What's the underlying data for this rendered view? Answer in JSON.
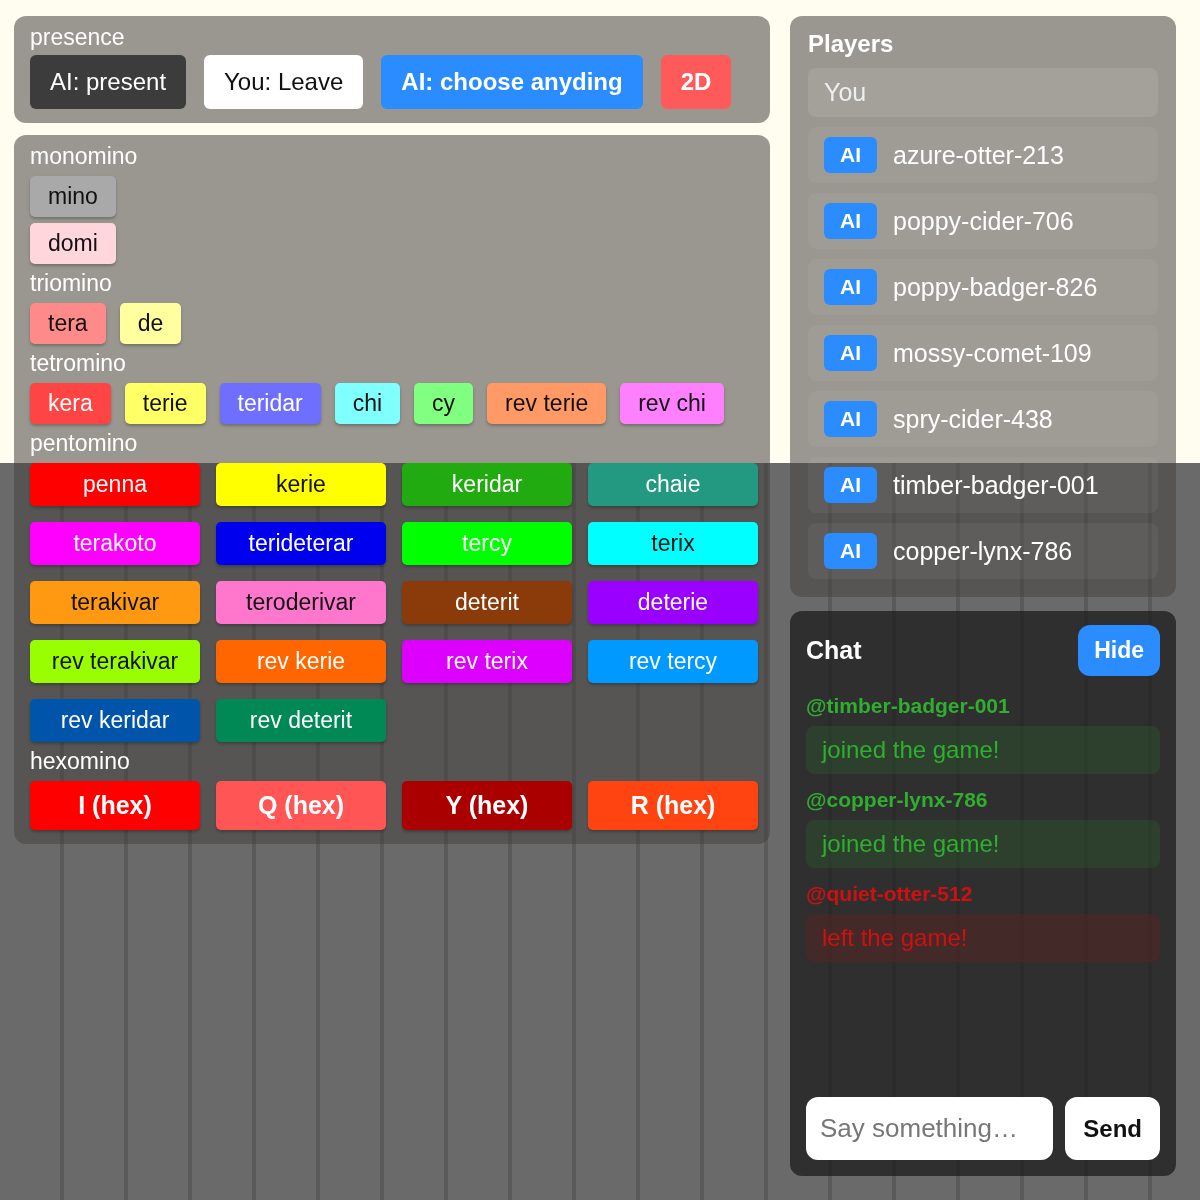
{
  "presence": {
    "label": "presence",
    "items": [
      {
        "kind": "status",
        "text": "AI: present"
      },
      {
        "kind": "leave",
        "text": "You: Leave"
      },
      {
        "kind": "choose",
        "text": "AI: choose anyding"
      },
      {
        "kind": "mode",
        "text": "2D"
      }
    ]
  },
  "palette": {
    "sections": [
      {
        "label": "monomino",
        "kind": "row",
        "chips": [
          {
            "text": "mino",
            "color": "#a9a9a9"
          }
        ]
      },
      {
        "kind": "row",
        "chips": [
          {
            "text": "domi",
            "color": "#ffd6dc"
          }
        ]
      },
      {
        "label": "triomino",
        "kind": "row",
        "chips": [
          {
            "text": "tera",
            "color": "#ff8a8a"
          },
          {
            "text": "de",
            "color": "#ffffa0"
          }
        ]
      },
      {
        "label": "tetromino",
        "kind": "row",
        "chips": [
          {
            "text": "kera",
            "color": "#ff4444"
          },
          {
            "text": "terie",
            "color": "#ffff66"
          },
          {
            "text": "teridar",
            "color": "#6e6eff"
          },
          {
            "text": "chi",
            "color": "#80ffff"
          },
          {
            "text": "cy",
            "color": "#80ff80"
          },
          {
            "text": "rev terie",
            "color": "#ff9966"
          },
          {
            "text": "rev chi",
            "color": "#ff80ff"
          }
        ]
      },
      {
        "label": "pentomino",
        "kind": "grid",
        "chips": [
          {
            "text": "penna",
            "color": "#ff0000"
          },
          {
            "text": "kerie",
            "color": "#ffff00"
          },
          {
            "text": "keridar",
            "color": "#22aa11"
          },
          {
            "text": "chaie",
            "color": "#229980"
          },
          {
            "text": "terakoto",
            "color": "#ff00ff"
          },
          {
            "text": "terideterar",
            "color": "#0000ee"
          },
          {
            "text": "tercy",
            "color": "#00ff00"
          },
          {
            "text": "terix",
            "color": "#00ffff"
          },
          {
            "text": "terakivar",
            "color": "#ff9911"
          },
          {
            "text": "teroderivar",
            "color": "#ff77cc"
          },
          {
            "text": "deterit",
            "color": "#8b3a0a"
          },
          {
            "text": "deterie",
            "color": "#9900ff"
          },
          {
            "text": "rev terakivar",
            "color": "#99ff00"
          },
          {
            "text": "rev kerie",
            "color": "#ff6600"
          },
          {
            "text": "rev terix",
            "color": "#dd00ff"
          },
          {
            "text": "rev tercy",
            "color": "#0099ff"
          },
          {
            "text": "rev keridar",
            "color": "#0055aa"
          },
          {
            "text": "rev deterit",
            "color": "#008855"
          }
        ]
      },
      {
        "label": "hexomino",
        "kind": "strong",
        "chips": [
          {
            "text": "I (hex)",
            "color": "#ff0000"
          },
          {
            "text": "Q (hex)",
            "color": "#ff5555"
          },
          {
            "text": "Y (hex)",
            "color": "#aa0000"
          },
          {
            "text": "R (hex)",
            "color": "#ff4411"
          }
        ]
      }
    ]
  },
  "players": {
    "title": "Players",
    "you": "You",
    "list": [
      {
        "badge": "AI",
        "name": "azure-otter-213"
      },
      {
        "badge": "AI",
        "name": "poppy-cider-706"
      },
      {
        "badge": "AI",
        "name": "poppy-badger-826"
      },
      {
        "badge": "AI",
        "name": "mossy-comet-109"
      },
      {
        "badge": "AI",
        "name": "spry-cider-438"
      },
      {
        "badge": "AI",
        "name": "timber-badger-001"
      },
      {
        "badge": "AI",
        "name": "copper-lynx-786"
      }
    ]
  },
  "chat": {
    "title": "Chat",
    "hide": "Hide",
    "messages": [
      {
        "kind": "join",
        "author": "@timber-badger-001",
        "text": "joined the game!"
      },
      {
        "kind": "join",
        "author": "@copper-lynx-786",
        "text": "joined the game!"
      },
      {
        "kind": "leave",
        "author": "@quiet-otter-512",
        "text": "left the game!"
      }
    ],
    "placeholder": "Say something…",
    "send": "Send"
  }
}
